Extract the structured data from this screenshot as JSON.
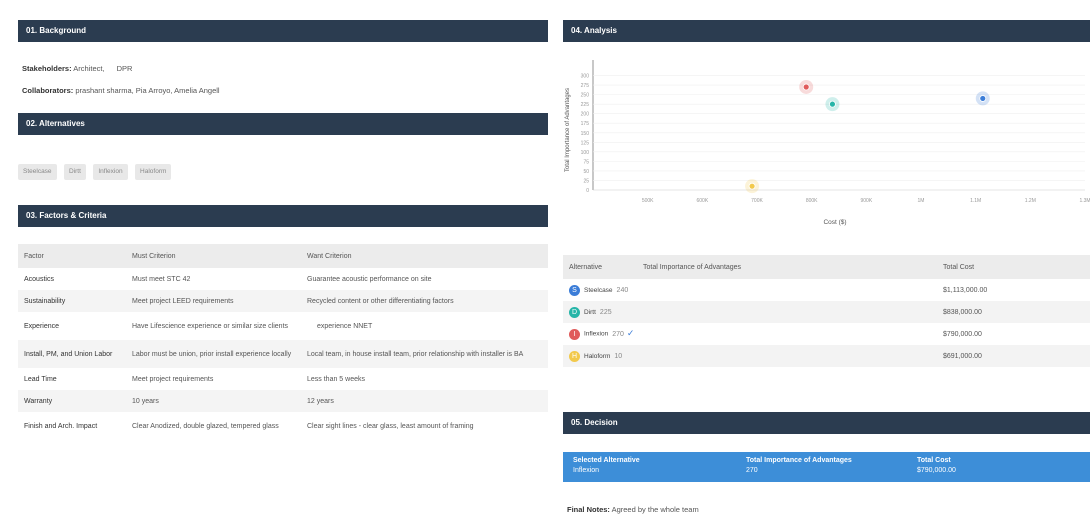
{
  "background": {
    "header": "01. Background",
    "stakeholders_label": "Stakeholders:",
    "stakeholders_value": "Architect,",
    "stakeholders_extra": "DPR",
    "collaborators_label": "Collaborators:",
    "collaborators_value": "prashant sharma, Pia Arroyo, Amelia Angell"
  },
  "alternatives": {
    "header": "02. Alternatives",
    "chips": [
      "Steelcase",
      "Dirtt",
      "Inflexion",
      "Haloform"
    ]
  },
  "factors": {
    "header": "03. Factors & Criteria",
    "columns": [
      "Factor",
      "Must Criterion",
      "Want Criterion"
    ],
    "rows": [
      {
        "factor": "Acoustics",
        "must": "Must meet STC 42",
        "want": "Guarantee acoustic performance on site"
      },
      {
        "factor": "Sustainability",
        "must": "Meet project LEED requirements",
        "want": "Recycled content or other differentiating factors"
      },
      {
        "factor": "Experience",
        "must": "Have Lifescience experience or similar size clients",
        "want": "experience NNET"
      },
      {
        "factor": "Install, PM, and Union Labor",
        "must": "Labor must be union, prior install experience locally",
        "want": "Local team, in house install team, prior relationship with installer is BA"
      },
      {
        "factor": "Lead Time",
        "must": "Meet project requirements",
        "want": "Less than 5 weeks"
      },
      {
        "factor": "Warranty",
        "must": "10 years",
        "want": "12 years"
      },
      {
        "factor": "Finish and Arch. Impact",
        "must": "Clear Anodized, double glazed, tempered glass",
        "want": "Clear sight lines - clear glass, least amount of framing"
      }
    ]
  },
  "analysis": {
    "header": "04. Analysis",
    "table_columns": [
      "Alternative",
      "Total Importance of Advantages",
      "Total Cost"
    ],
    "table_rows": [
      {
        "letter": "S",
        "color": "#3b7dd8",
        "name": "Steelcase",
        "importance": "240",
        "cost": "$1,113,000.00",
        "selected": false
      },
      {
        "letter": "D",
        "color": "#26b5a8",
        "name": "Dirtt",
        "importance": "225",
        "cost": "$838,000.00",
        "selected": false
      },
      {
        "letter": "I",
        "color": "#e05b5b",
        "name": "Inflexion",
        "importance": "270",
        "cost": "$790,000.00",
        "selected": true
      },
      {
        "letter": "H",
        "color": "#f2c94c",
        "name": "Haloform",
        "importance": "10",
        "cost": "$691,000.00",
        "selected": false
      }
    ]
  },
  "chart_data": {
    "type": "scatter",
    "xlabel": "Cost ($)",
    "ylabel": "Total Importance of Advantages",
    "xlim": [
      400000,
      1300000
    ],
    "ylim": [
      0,
      325
    ],
    "x_ticks": [
      "500K",
      "600K",
      "700K",
      "800K",
      "900K",
      "1M",
      "1.1M",
      "1.2M",
      "1.3M"
    ],
    "x_tick_values": [
      500000,
      600000,
      700000,
      800000,
      900000,
      1000000,
      1100000,
      1200000,
      1300000
    ],
    "y_ticks": [
      "0",
      "25",
      "50",
      "75",
      "100",
      "125",
      "150",
      "175",
      "200",
      "225",
      "250",
      "275",
      "300"
    ],
    "series": [
      {
        "label": "S",
        "x": 1113000,
        "y": 240,
        "color": "#3b7dd8"
      },
      {
        "label": "D",
        "x": 838000,
        "y": 225,
        "color": "#26b5a8"
      },
      {
        "label": "I",
        "x": 790000,
        "y": 270,
        "color": "#e05b5b"
      },
      {
        "label": "H",
        "x": 691000,
        "y": 10,
        "color": "#f2c94c"
      }
    ]
  },
  "decision": {
    "header": "05. Decision",
    "selected_label": "Selected Alternative",
    "selected_value": "Inflexion",
    "importance_label": "Total Importance of Advantages",
    "importance_value": "270",
    "cost_label": "Total Cost",
    "cost_value": "$790,000.00",
    "final_notes_label": "Final Notes:",
    "final_notes_value": "Agreed by the whole team"
  }
}
